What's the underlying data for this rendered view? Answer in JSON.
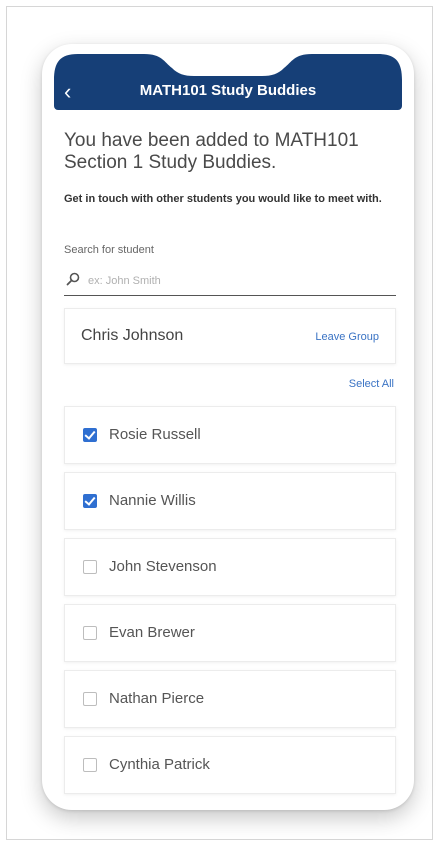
{
  "header": {
    "back_icon": "chevron-left-icon",
    "title": "MATH101 Study Buddies"
  },
  "intro": {
    "title": "You have been added to MATH101 Section 1 Study Buddies.",
    "subtitle": "Get in touch with other students you would like to meet with."
  },
  "search": {
    "label": "Search for student",
    "placeholder": "ex: John Smith",
    "value": "",
    "icon": "search-icon"
  },
  "owner": {
    "name": "Chris Johnson",
    "leave_label": "Leave Group"
  },
  "select_all_label": "Select All",
  "students": [
    {
      "name": "Rosie Russell",
      "checked": true
    },
    {
      "name": "Nannie Willis",
      "checked": true
    },
    {
      "name": "John Stevenson",
      "checked": false
    },
    {
      "name": "Evan Brewer",
      "checked": false
    },
    {
      "name": "Nathan Pierce",
      "checked": false
    },
    {
      "name": "Cynthia Patrick",
      "checked": false
    }
  ],
  "colors": {
    "header_bg": "#163f77",
    "link": "#3a73c4",
    "checkbox_checked": "#2f6fd1"
  }
}
